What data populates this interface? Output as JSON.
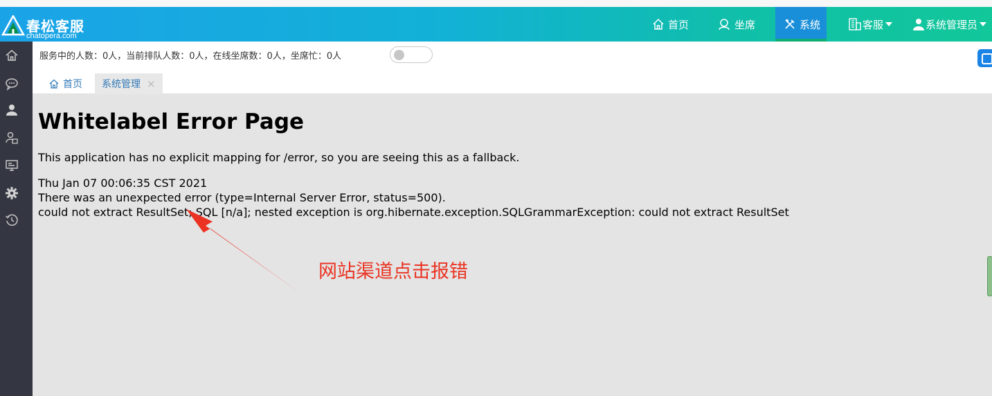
{
  "app": {
    "logo_cn": "春松客服",
    "logo_en": "chatopera.com"
  },
  "nav": {
    "home": "首页",
    "seat": "坐席",
    "system": "系统",
    "service": "客服",
    "admin": "系统管理员"
  },
  "status": {
    "text": "服务中的人数：0人，当前排队人数：0人，在线坐席数：0人，坐席忙：0人",
    "toggle_on": false
  },
  "tabs": [
    {
      "label": "首页",
      "active": false
    },
    {
      "label": "系统管理",
      "active": true
    }
  ],
  "tab_close": "×",
  "error": {
    "title": "Whitelabel Error Page",
    "description": "This application has no explicit mapping for /error, so you are seeing this as a fallback.",
    "timestamp": "Thu Jan 07 00:06:35 CST 2021",
    "message": "There was an unexpected error (type=Internal Server Error, status=500).",
    "detail": "could not extract ResultSet; SQL [n/a]; nested exception is org.hibernate.exception.SQLGrammarException: could not extract ResultSet"
  },
  "annotation": {
    "text": "网站渠道点击报错",
    "color": "#ea3323"
  },
  "sidebar": {
    "icons": [
      "home-icon",
      "chat-bubble-icon",
      "user-icon",
      "contact-card-icon",
      "monitor-icon",
      "gear-icon",
      "history-icon"
    ]
  },
  "colors": {
    "header_start": "#1ba3e8",
    "header_end": "#12c79a",
    "active_nav": "#1a8fd9",
    "sidebar": "#343741",
    "link": "#337ab7"
  }
}
